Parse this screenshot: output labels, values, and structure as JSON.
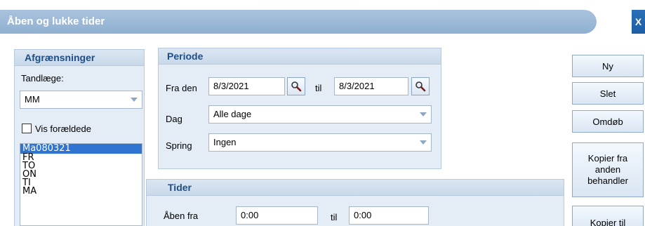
{
  "window": {
    "title": "Åben og lukke tider",
    "close_label": "X"
  },
  "afgraensninger": {
    "header": "Afgrænsninger",
    "tandlaege_label": "Tandlæge:",
    "tandlaege_value": "MM",
    "vis_foraeldede_label": "Vis forældede",
    "vis_foraeldede_checked": false,
    "list_items": [
      "Ma080321",
      "FR",
      "TO",
      "ON",
      "TI",
      "MA"
    ],
    "selected_index": 0
  },
  "periode": {
    "header": "Periode",
    "fra_den_label": "Fra den",
    "fra_den_value": "8/3/2021",
    "til_label": "til",
    "til_value": "8/3/2021",
    "dag_label": "Dag",
    "dag_value": "Alle dage",
    "spring_label": "Spring",
    "spring_value": "Ingen"
  },
  "tider": {
    "header": "Tider",
    "aaben_fra_label": "Åben fra",
    "aaben_fra_value": "0:00",
    "til_label": "til",
    "til_value": "0:00"
  },
  "buttons": {
    "ny": "Ny",
    "slet": "Slet",
    "omdoeb": "Omdøb",
    "kopier_fra_anden": "Kopier fra\nanden\nbehandler",
    "kopier_til": "Kopier til"
  },
  "colors": {
    "accent": "#1f4e86",
    "selection": "#2f74d0",
    "group_bg": "#e4ecf5"
  }
}
